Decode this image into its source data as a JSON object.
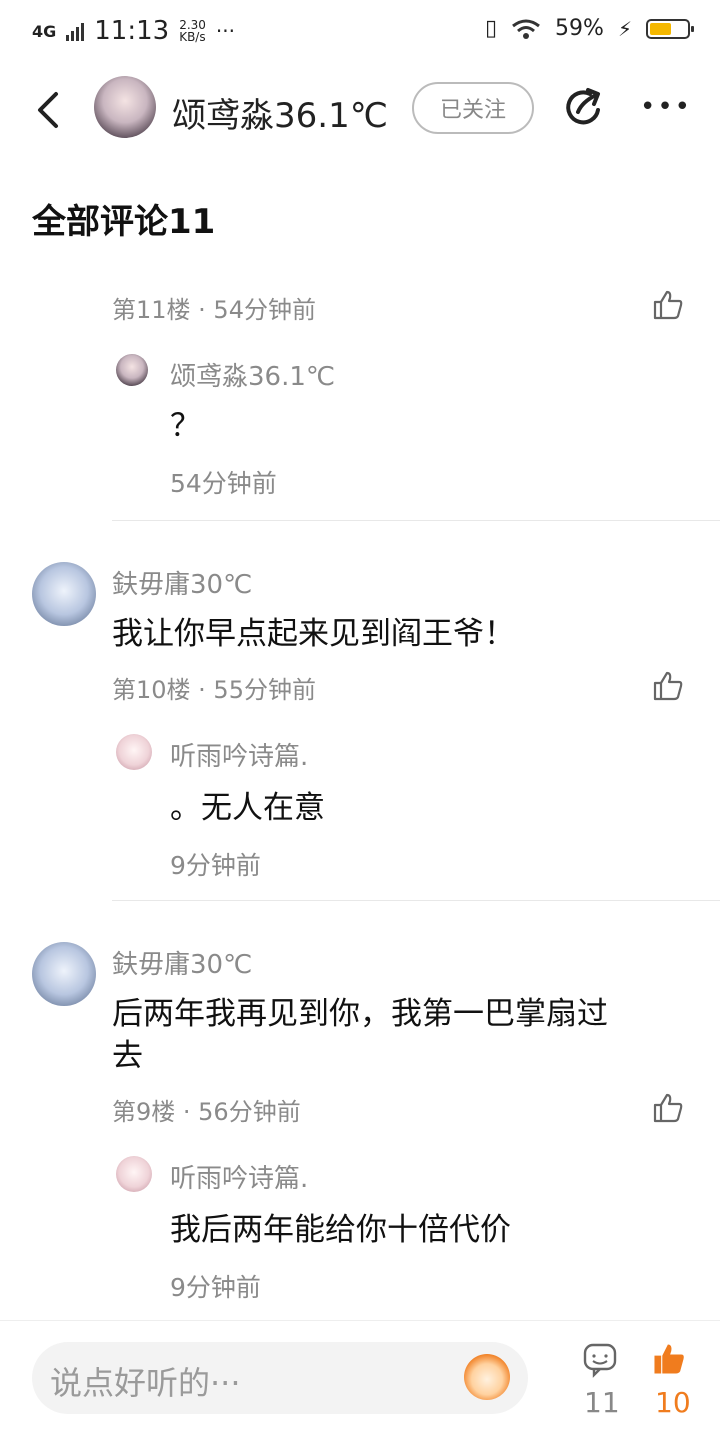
{
  "status_bar": {
    "network": "4G",
    "time": "11:13",
    "speed": "2.30",
    "speed_unit": "KB/s",
    "more": "···",
    "battery_pct": "59%",
    "battery_level": 0.59
  },
  "header": {
    "username": "颂鸢淼36.1℃",
    "follow_label": "已关注",
    "more": "•••"
  },
  "section_title": "全部评论11",
  "comments": [
    {
      "floor_time": "第11楼 · 54分钟前",
      "reply": {
        "name": "颂鸢淼36.1℃",
        "text": "？",
        "time": "54分钟前"
      }
    },
    {
      "name": "鈇毋庸30℃",
      "text": "我让你早点起来见到阎王爷！",
      "floor_time": "第10楼 · 55分钟前",
      "reply": {
        "name": "听雨吟诗篇.",
        "text": "。无人在意",
        "time": "9分钟前"
      }
    },
    {
      "name": "鈇毋庸30℃",
      "text_line1": "后两年我再见到你，我第一巴掌扇过",
      "text_line2": "去",
      "floor_time": "第9楼 · 56分钟前",
      "reply": {
        "name": "听雨吟诗篇.",
        "text": "我后两年能给你十倍代价",
        "time": "9分钟前"
      }
    }
  ],
  "bottom_bar": {
    "input_placeholder": "说点好听的···",
    "comment_count": "11",
    "like_count": "10",
    "accent": "#f07c1e"
  }
}
